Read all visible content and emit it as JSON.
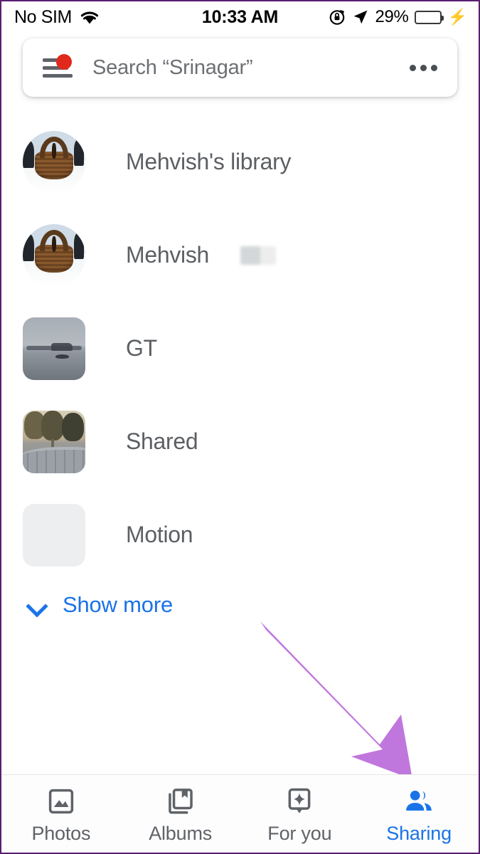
{
  "status_bar": {
    "carrier": "No SIM",
    "wifi_icon": "wifi-icon",
    "time": "10:33 AM",
    "rotation_lock_icon": "rotation-lock-icon",
    "location_icon": "location-arrow-icon",
    "battery_percent": "29%",
    "battery_level": 29,
    "battery_color": "#fcc300",
    "charging_icon": "lightning-bolt-icon"
  },
  "search": {
    "menu_icon": "hamburger-menu-icon",
    "has_notification_badge": true,
    "badge_color": "#e0291c",
    "placeholder": "Search “Srinagar”",
    "overflow_icon": "three-dots-icon"
  },
  "list": {
    "items": [
      {
        "label": "Mehvish's library",
        "thumb_shape": "circle",
        "thumb_art": "basket",
        "redacted": false
      },
      {
        "label": "Mehvish",
        "thumb_shape": "circle",
        "thumb_art": "basket",
        "redacted": true
      },
      {
        "label": "GT",
        "thumb_shape": "rounded",
        "thumb_art": "lake",
        "redacted": false
      },
      {
        "label": "Shared",
        "thumb_shape": "rounded",
        "thumb_art": "park",
        "redacted": false
      },
      {
        "label": "Motion",
        "thumb_shape": "rounded",
        "thumb_art": "blank",
        "redacted": false
      }
    ]
  },
  "show_more": {
    "label": "Show more",
    "icon": "chevron-down-icon",
    "color": "#1a73e8"
  },
  "annotation": {
    "type": "arrow",
    "color": "#c077dd",
    "points_to": "Sharing",
    "direction": "down-right"
  },
  "tab_bar": {
    "active_color": "#1a73e8",
    "inactive_color": "#5f6368",
    "tabs": [
      {
        "label": "Photos",
        "icon": "photo-icon",
        "active": false
      },
      {
        "label": "Albums",
        "icon": "albums-icon",
        "active": false
      },
      {
        "label": "For you",
        "icon": "sparkle-icon",
        "active": false
      },
      {
        "label": "Sharing",
        "icon": "people-icon",
        "active": true
      }
    ]
  }
}
